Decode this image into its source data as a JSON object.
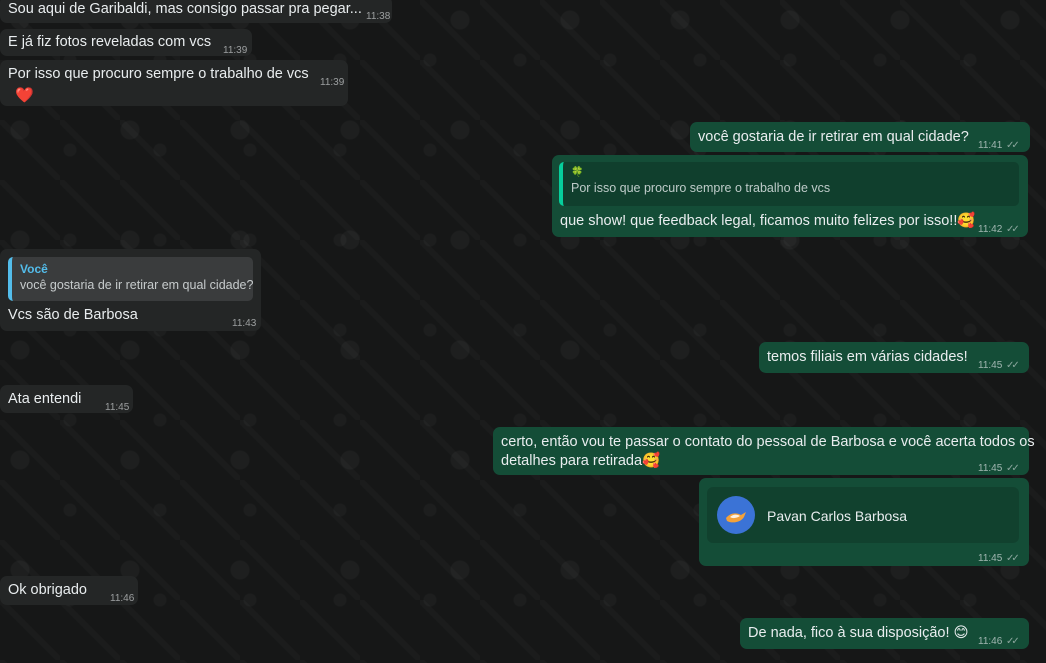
{
  "messages": [
    {
      "id": "m1",
      "text": "Sou aqui de Garibaldi, mas consigo passar pra pegar...",
      "time": "11:38"
    },
    {
      "id": "m2",
      "text": "E já fiz fotos reveladas com vcs",
      "time": "11:39"
    },
    {
      "id": "m3",
      "text": "Por isso que procuro sempre o trabalho de vcs",
      "emoji": "❤️",
      "time": "11:39"
    },
    {
      "id": "m4",
      "text": "você gostaria de ir retirar em qual cidade?",
      "time": "11:41"
    },
    {
      "id": "m5",
      "quote_icon": "🍀",
      "quote_text": "Por isso que procuro sempre o trabalho de vcs",
      "text": "que show! que feedback legal, ficamos muito felizes por isso!!🥰",
      "time": "11:42"
    },
    {
      "id": "m6",
      "quote_author": "Você",
      "quote_text": "você gostaria de ir retirar em qual cidade?",
      "text": "Vcs são de Barbosa",
      "time": "11:43"
    },
    {
      "id": "m7",
      "text": "temos filiais em várias cidades!",
      "time": "11:45"
    },
    {
      "id": "m8",
      "text": "Ata entendi",
      "time": "11:45"
    },
    {
      "id": "m9",
      "line1": "certo, então vou te passar o contato do pessoal de Barbosa e você acerta todos os",
      "line2": "detalhes para retirada🥰",
      "time": "11:45"
    },
    {
      "id": "m10",
      "contact_name": "Pavan Carlos Barbosa",
      "time": "11:45"
    },
    {
      "id": "m11",
      "text": "Ok obrigado",
      "time": "11:46"
    },
    {
      "id": "m12",
      "text": "De nada, fico à sua disposição! 😊",
      "time": "11:46"
    }
  ],
  "ticks_glyph": "✓✓",
  "colors": {
    "incoming": "#242626",
    "outgoing": "#144d37",
    "accent_green": "#06cf9c",
    "accent_blue": "#53bdeb"
  }
}
